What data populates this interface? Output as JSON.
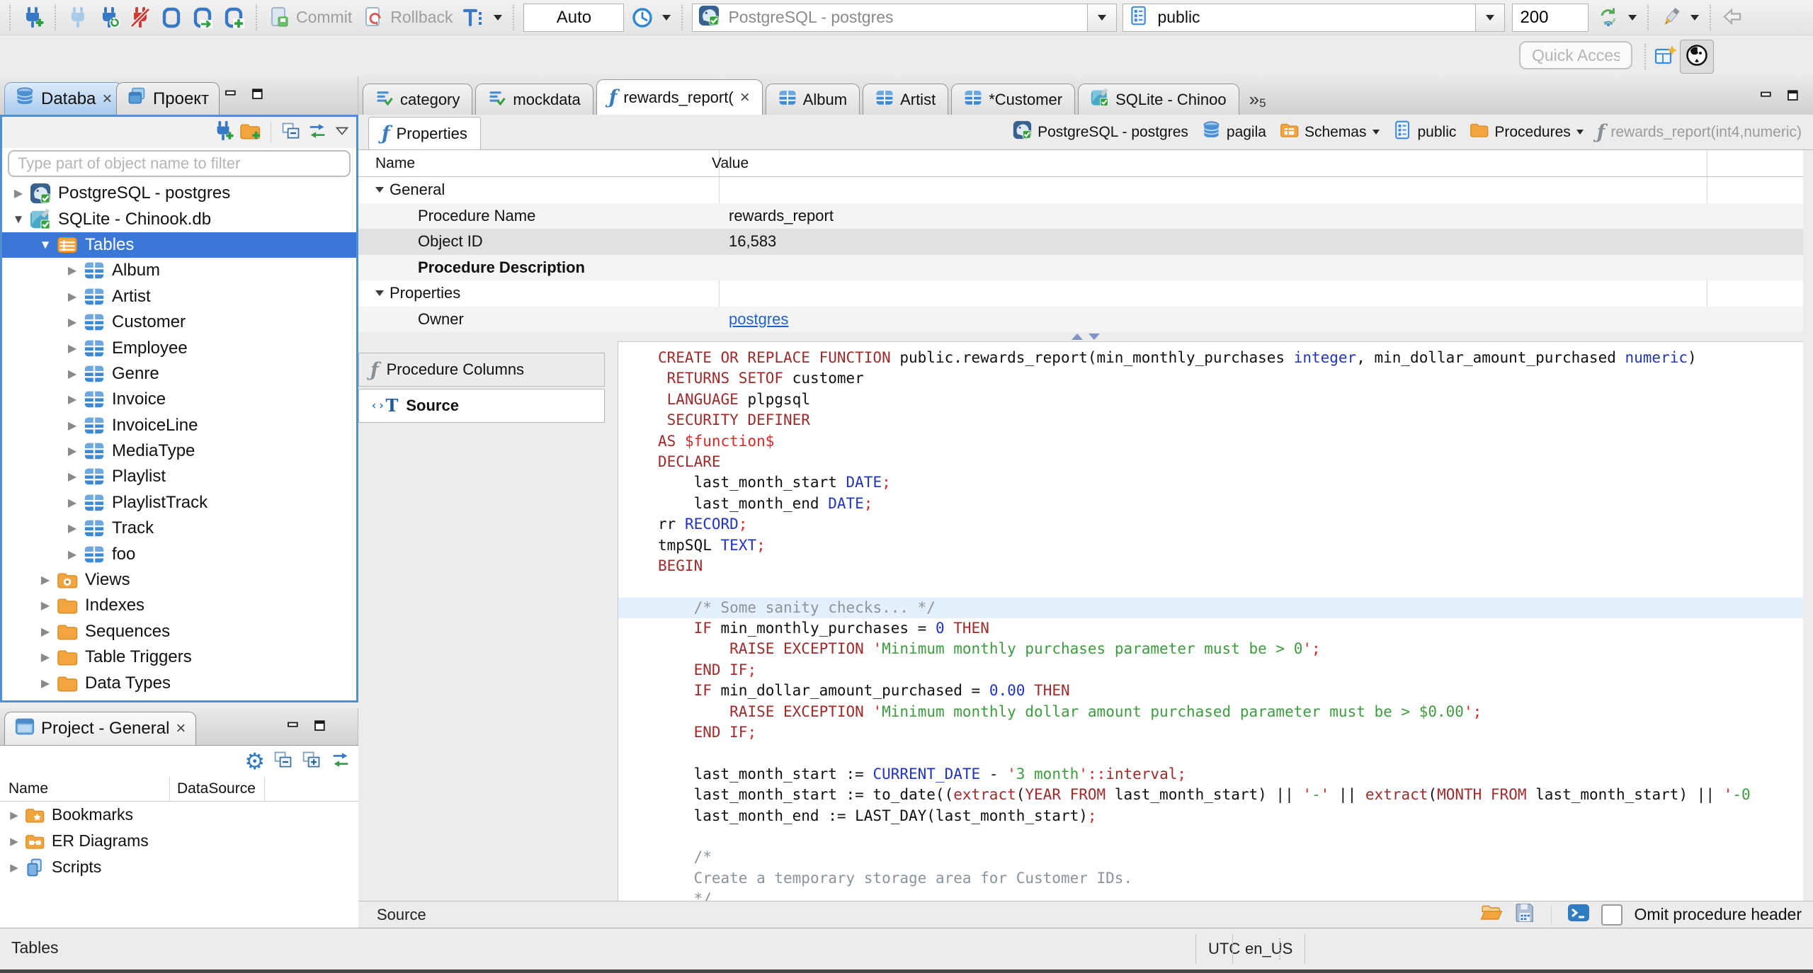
{
  "window": {
    "quick_access_placeholder": "Quick Access"
  },
  "toolbar": {
    "commit_label": "Commit",
    "rollback_label": "Rollback",
    "auto_label": "Auto",
    "connection_value": "PostgreSQL - postgres",
    "schema_value": "public",
    "fetch_size_value": "200"
  },
  "left_tabs": {
    "navigator_label": "Databa",
    "project_label": "Проект"
  },
  "navigator": {
    "filter_placeholder": "Type part of object name to filter",
    "tree": [
      {
        "label": "PostgreSQL - postgres",
        "icon": "pg",
        "depth": 0,
        "arrow": "c"
      },
      {
        "label": "SQLite - Chinook.db",
        "icon": "sqlite",
        "depth": 0,
        "arrow": "e"
      },
      {
        "label": "Tables",
        "icon": "tablesFolder",
        "depth": 1,
        "arrow": "e",
        "selected": true
      },
      {
        "label": "Album",
        "icon": "table",
        "depth": 2,
        "arrow": "c"
      },
      {
        "label": "Artist",
        "icon": "table",
        "depth": 2,
        "arrow": "c"
      },
      {
        "label": "Customer",
        "icon": "table",
        "depth": 2,
        "arrow": "c"
      },
      {
        "label": "Employee",
        "icon": "table",
        "depth": 2,
        "arrow": "c"
      },
      {
        "label": "Genre",
        "icon": "table",
        "depth": 2,
        "arrow": "c"
      },
      {
        "label": "Invoice",
        "icon": "table",
        "depth": 2,
        "arrow": "c"
      },
      {
        "label": "InvoiceLine",
        "icon": "table",
        "depth": 2,
        "arrow": "c"
      },
      {
        "label": "MediaType",
        "icon": "table",
        "depth": 2,
        "arrow": "c"
      },
      {
        "label": "Playlist",
        "icon": "table",
        "depth": 2,
        "arrow": "c"
      },
      {
        "label": "PlaylistTrack",
        "icon": "table",
        "depth": 2,
        "arrow": "c"
      },
      {
        "label": "Track",
        "icon": "table",
        "depth": 2,
        "arrow": "c"
      },
      {
        "label": "foo",
        "icon": "table",
        "depth": 2,
        "arrow": "c"
      },
      {
        "label": "Views",
        "icon": "viewsFolder",
        "depth": 1,
        "arrow": "c"
      },
      {
        "label": "Indexes",
        "icon": "folder",
        "depth": 1,
        "arrow": "c"
      },
      {
        "label": "Sequences",
        "icon": "folder",
        "depth": 1,
        "arrow": "c"
      },
      {
        "label": "Table Triggers",
        "icon": "folder",
        "depth": 1,
        "arrow": "c"
      },
      {
        "label": "Data Types",
        "icon": "folder",
        "depth": 1,
        "arrow": "c"
      }
    ]
  },
  "project_panel": {
    "title": "Project - General",
    "columns": [
      "Name",
      "DataSource"
    ],
    "items": [
      {
        "label": "Bookmarks",
        "icon": "bookmarksFolder"
      },
      {
        "label": "ER Diagrams",
        "icon": "erFolder"
      },
      {
        "label": "Scripts",
        "icon": "scripts"
      }
    ]
  },
  "editor_tabs": {
    "tabs": [
      {
        "label": "category",
        "icon": "sqlScript"
      },
      {
        "label": "mockdata",
        "icon": "sqlScript"
      },
      {
        "label": "rewards_report(",
        "icon": "func",
        "active": true,
        "closable": true
      },
      {
        "label": "Album",
        "icon": "table"
      },
      {
        "label": "Artist",
        "icon": "table"
      },
      {
        "label": "*Customer",
        "icon": "table"
      },
      {
        "label": "SQLite - Chinoo",
        "icon": "sqlite"
      }
    ],
    "overflow_count": "5"
  },
  "properties_view": {
    "tab_label": "Properties",
    "breadcrumb": [
      {
        "label": "PostgreSQL - postgres",
        "icon": "pg"
      },
      {
        "label": "pagila",
        "icon": "dbBlue"
      },
      {
        "label": "Schemas",
        "icon": "schemasFolder",
        "dropdown": true
      },
      {
        "label": "public",
        "icon": "schemaPage"
      },
      {
        "label": "Procedures",
        "icon": "folder",
        "dropdown": true
      },
      {
        "label": "rewards_report(int4,numeric)",
        "icon": "funcGray",
        "muted": true
      }
    ],
    "columns": [
      "Name",
      "Value"
    ],
    "rows": [
      {
        "type": "group",
        "name": "General"
      },
      {
        "type": "item",
        "name": "Procedure Name",
        "value": "rewards_report",
        "stripe": true
      },
      {
        "type": "item",
        "name": "Object ID",
        "value": "16,583",
        "selected": true
      },
      {
        "type": "item",
        "name": "Procedure Description",
        "value": "",
        "bold": true,
        "stripe": true
      },
      {
        "type": "group",
        "name": "Properties"
      },
      {
        "type": "item",
        "name": "Owner",
        "value": "postgres",
        "link": true,
        "stripe": true
      }
    ]
  },
  "subtabs": [
    {
      "label": "Procedure Columns",
      "icon": "funcGray"
    },
    {
      "label": "Source",
      "icon": "sourceIc",
      "active": true
    }
  ],
  "source": {
    "footer_label": "Source",
    "omit_checkbox_label": "Omit procedure header",
    "lines": [
      {
        "tk": [
          [
            "CREATE OR REPLACE FUNCTION",
            "kw"
          ],
          [
            " public.rewards_report(min_monthly_purchases ",
            "p"
          ],
          [
            "integer",
            "ty"
          ],
          [
            ", min_dollar_amount_purchased ",
            "p"
          ],
          [
            "numeric",
            "ty"
          ],
          [
            ")",
            "p"
          ]
        ]
      },
      {
        "tk": [
          [
            " ",
            "p"
          ],
          [
            "RETURNS SETOF",
            "kw"
          ],
          [
            " customer",
            "p"
          ]
        ]
      },
      {
        "tk": [
          [
            " ",
            "p"
          ],
          [
            "LANGUAGE",
            "kw"
          ],
          [
            " plpgsql",
            "p"
          ]
        ]
      },
      {
        "tk": [
          [
            " ",
            "p"
          ],
          [
            "SECURITY DEFINER",
            "kw"
          ]
        ]
      },
      {
        "tk": [
          [
            "AS",
            "kw"
          ],
          [
            " ",
            "p"
          ],
          [
            "$function$",
            "red"
          ]
        ]
      },
      {
        "tk": [
          [
            "DECLARE",
            "kw"
          ]
        ]
      },
      {
        "tk": [
          [
            "    last_month_start ",
            "p"
          ],
          [
            "DATE",
            "ty"
          ],
          [
            ";",
            "red"
          ]
        ]
      },
      {
        "tk": [
          [
            "    last_month_end ",
            "p"
          ],
          [
            "DATE",
            "ty"
          ],
          [
            ";",
            "red"
          ]
        ]
      },
      {
        "tk": [
          [
            "rr ",
            "p"
          ],
          [
            "RECORD",
            "ty"
          ],
          [
            ";",
            "red"
          ]
        ]
      },
      {
        "tk": [
          [
            "tmpSQL ",
            "p"
          ],
          [
            "TEXT",
            "ty"
          ],
          [
            ";",
            "red"
          ]
        ]
      },
      {
        "tk": [
          [
            "BEGIN",
            "kw"
          ]
        ]
      },
      {
        "tk": []
      },
      {
        "hl": true,
        "tk": [
          [
            "    ",
            "p"
          ],
          [
            "/* Some sanity checks... */",
            "cmt"
          ]
        ]
      },
      {
        "tk": [
          [
            "    ",
            "p"
          ],
          [
            "IF",
            "kw"
          ],
          [
            " min_monthly_purchases = ",
            "p"
          ],
          [
            "0",
            "num"
          ],
          [
            " ",
            "p"
          ],
          [
            "THEN",
            "kw"
          ]
        ]
      },
      {
        "tk": [
          [
            "        ",
            "p"
          ],
          [
            "RAISE EXCEPTION",
            "kw"
          ],
          [
            " ",
            "p"
          ],
          [
            "'",
            "red"
          ],
          [
            "Minimum monthly purchases parameter must be > 0",
            "str"
          ],
          [
            "'",
            "red"
          ],
          [
            ";",
            "red"
          ]
        ]
      },
      {
        "tk": [
          [
            "    ",
            "p"
          ],
          [
            "END IF",
            "kw"
          ],
          [
            ";",
            "red"
          ]
        ]
      },
      {
        "tk": [
          [
            "    ",
            "p"
          ],
          [
            "IF",
            "kw"
          ],
          [
            " min_dollar_amount_purchased = ",
            "p"
          ],
          [
            "0.00",
            "num"
          ],
          [
            " ",
            "p"
          ],
          [
            "THEN",
            "kw"
          ]
        ]
      },
      {
        "tk": [
          [
            "        ",
            "p"
          ],
          [
            "RAISE EXCEPTION",
            "kw"
          ],
          [
            " ",
            "p"
          ],
          [
            "'",
            "red"
          ],
          [
            "Minimum monthly dollar amount purchased parameter must be > $0.00",
            "str"
          ],
          [
            "'",
            "red"
          ],
          [
            ";",
            "red"
          ]
        ]
      },
      {
        "tk": [
          [
            "    ",
            "p"
          ],
          [
            "END IF",
            "kw"
          ],
          [
            ";",
            "red"
          ]
        ]
      },
      {
        "tk": []
      },
      {
        "tk": [
          [
            "    last_month_start := ",
            "p"
          ],
          [
            "CURRENT_DATE",
            "ty"
          ],
          [
            " - ",
            "p"
          ],
          [
            "'",
            "red"
          ],
          [
            "3 month",
            "str"
          ],
          [
            "'",
            "red"
          ],
          [
            "::",
            "red"
          ],
          [
            "interval",
            "kw"
          ],
          [
            ";",
            "red"
          ]
        ]
      },
      {
        "tk": [
          [
            "    last_month_start := to_date((",
            "p"
          ],
          [
            "extract",
            "kw"
          ],
          [
            "(",
            "p"
          ],
          [
            "YEAR FROM",
            "kw"
          ],
          [
            " last_month_start) || ",
            "p"
          ],
          [
            "'",
            "red"
          ],
          [
            "-",
            "str"
          ],
          [
            "'",
            "red"
          ],
          [
            " || ",
            "p"
          ],
          [
            "extract",
            "kw"
          ],
          [
            "(",
            "p"
          ],
          [
            "MONTH FROM",
            "kw"
          ],
          [
            " last_month_start) || ",
            "p"
          ],
          [
            "'",
            "red"
          ],
          [
            "-0",
            "str"
          ]
        ]
      },
      {
        "tk": [
          [
            "    last_month_end := LAST_DAY(last_month_start)",
            "p"
          ],
          [
            ";",
            "red"
          ]
        ]
      },
      {
        "tk": []
      },
      {
        "tk": [
          [
            "    ",
            "p"
          ],
          [
            "/*",
            "cmt"
          ]
        ]
      },
      {
        "tk": [
          [
            "    ",
            "p"
          ],
          [
            "Create a temporary storage area for Customer IDs.",
            "cmt"
          ]
        ]
      },
      {
        "tk": [
          [
            "    ",
            "p"
          ],
          [
            "*/",
            "cmt"
          ]
        ]
      }
    ]
  },
  "statusbar": {
    "left": "Tables",
    "timezone": "UTC",
    "locale": "en_US"
  }
}
